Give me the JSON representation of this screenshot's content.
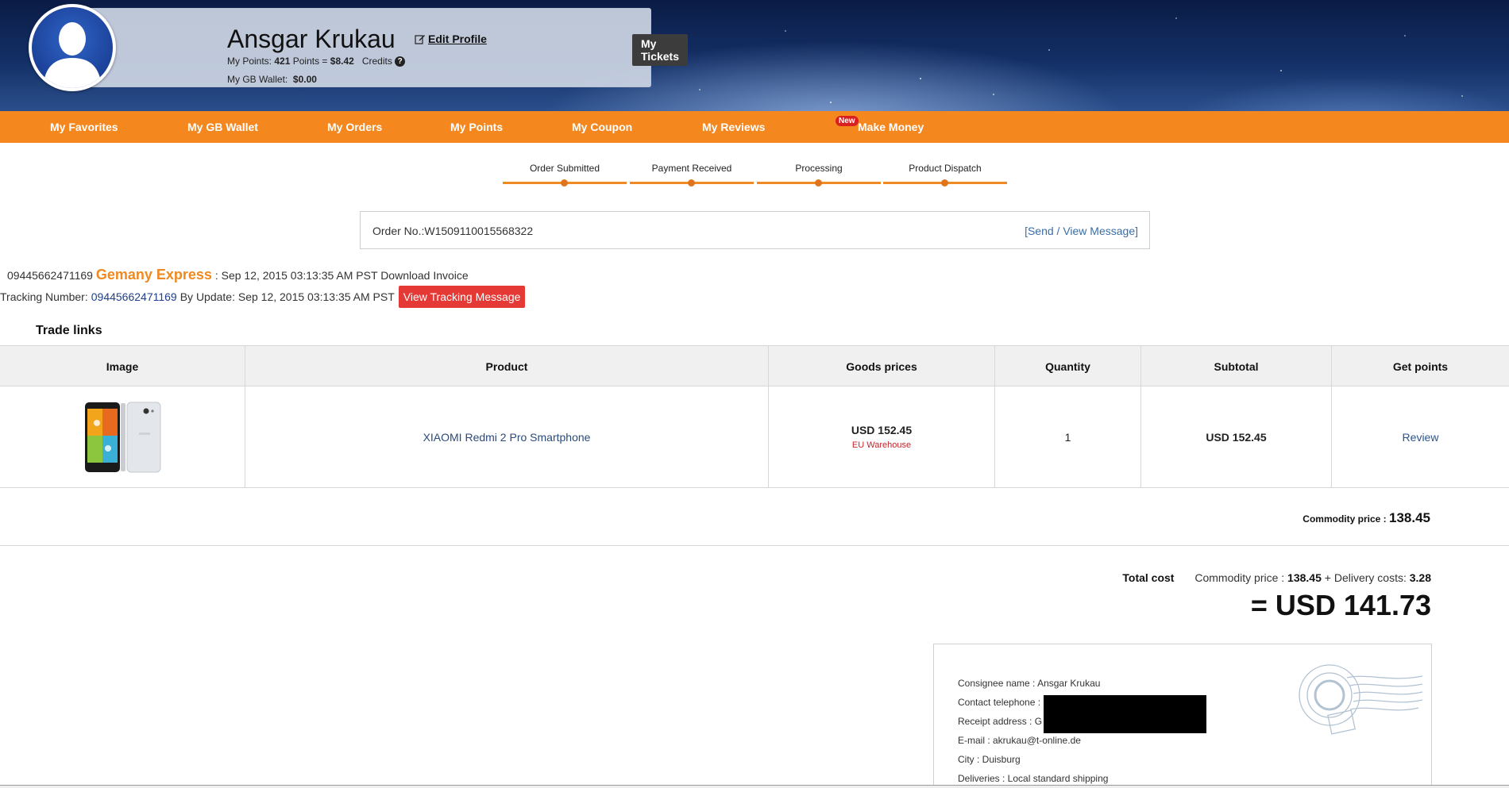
{
  "profile": {
    "name": "Ansgar Krukau",
    "edit_label": "Edit Profile",
    "points_prefix": "My Points:",
    "points_value": "421",
    "points_mid": "Points =",
    "points_money": "$8.42",
    "credits_label": "Credits",
    "wallet_label": "My GB Wallet:",
    "wallet_value": "$0.00",
    "tickets_label": "My Tickets"
  },
  "nav": {
    "items": [
      "My Favorites",
      "My GB Wallet",
      "My Orders",
      "My Points",
      "My Coupon",
      "My Reviews",
      "Make Money"
    ],
    "new_badge": "New"
  },
  "steps": [
    "Order Submitted",
    "Payment Received",
    "Processing",
    "Product Dispatch"
  ],
  "order": {
    "number_text": "Order No.:W1509110015568322",
    "message_link": "[Send / View Message]"
  },
  "shipping": {
    "tracking_number": "09445662471169",
    "carrier": "Gemany Express",
    "date_text": ": Sep 12, 2015 03:13:35 AM PST",
    "invoice_link": "Download Invoice",
    "tracking_label": "Tracking Number:",
    "update_text": "By Update: Sep 12, 2015 03:13:35 AM PST",
    "view_tracking_label": "View Tracking Message"
  },
  "trade_links_title": "Trade links",
  "table": {
    "headers": [
      "Image",
      "Product",
      "Goods prices",
      "Quantity",
      "Subtotal",
      "Get points"
    ],
    "rows": [
      {
        "product": "XIAOMI Redmi 2 Pro Smartphone",
        "price": "USD 152.45",
        "warehouse": "EU Warehouse",
        "quantity": "1",
        "subtotal": "USD 152.45",
        "points_action": "Review"
      }
    ]
  },
  "totals": {
    "commodity_label": "Commodity price :",
    "commodity_value": "138.45",
    "total_cost_label": "Total cost",
    "breakdown_commodity_label": "Commodity price :",
    "breakdown_commodity_value": "138.45",
    "breakdown_plus": "+ Delivery costs:",
    "delivery_value": "3.28",
    "grand_total": "= USD 141.73"
  },
  "consignee": {
    "name": "Consignee name : Ansgar Krukau",
    "telephone": "Contact telephone :",
    "address": "Receipt address : G",
    "email": "E-mail : akrukau@t-online.de",
    "city": "City : Duisburg",
    "deliveries": "Deliveries : Local standard shipping"
  },
  "colors": {
    "nav_orange": "#f5871f",
    "carrier_orange": "#ef8a22",
    "tracking_red": "#e53935",
    "warehouse_red": "#c0272d"
  },
  "icons": [
    "user-avatar-icon",
    "edit-icon",
    "help-icon",
    "postmark-stamp-icon"
  ]
}
